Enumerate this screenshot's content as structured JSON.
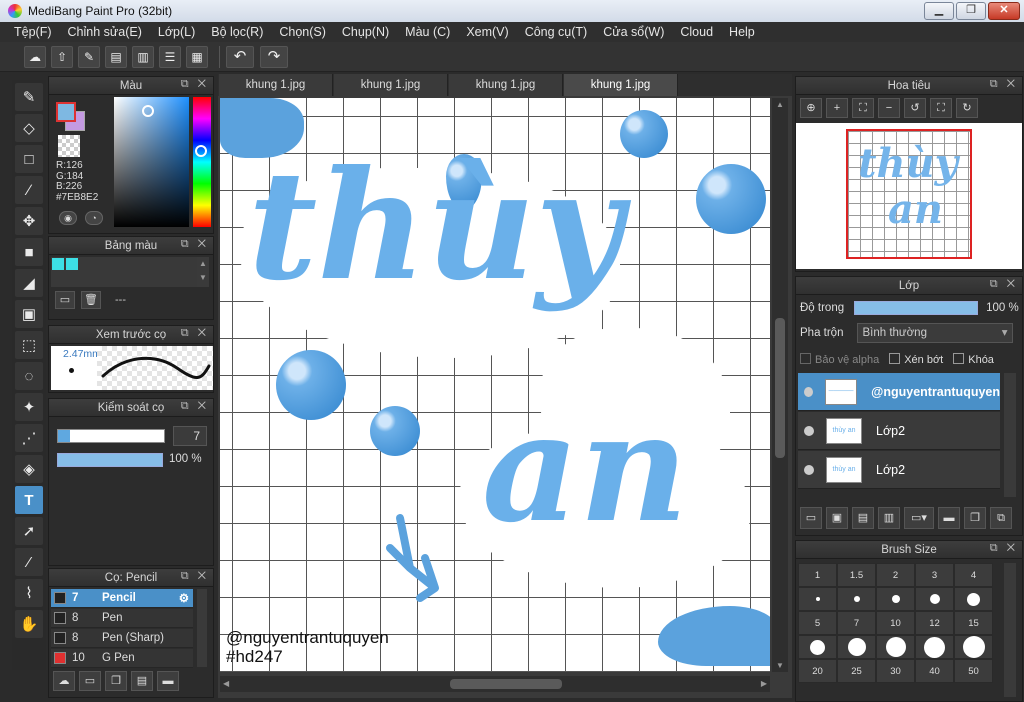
{
  "window": {
    "title": "MediBang Paint Pro (32bit)",
    "min": "▁",
    "max": "❐",
    "close": "✕"
  },
  "menu": [
    "Tệp(F)",
    "Chỉnh sửa(E)",
    "Lớp(L)",
    "Bộ lọc(R)",
    "Chọn(S)",
    "Chụp(N)",
    "Màu (C)",
    "Xem(V)",
    "Công cụ(T)",
    "Cửa sổ(W)",
    "Cloud",
    "Help"
  ],
  "toolbar": {
    "undo": "↶",
    "redo": "↷"
  },
  "color_panel": {
    "title": "Màu",
    "foreground": "#7EB8E2",
    "background": "#C49AE2",
    "r": "R:126",
    "g": "G:184",
    "b": "B:226",
    "hex": "#7EB8E2"
  },
  "palette_panel": {
    "title": "Bảng màu",
    "name": "---",
    "colors": [
      "#3DE0E6",
      "#3DE0E6"
    ]
  },
  "preview_panel": {
    "title": "Xem trước cọ",
    "size": "2.47mm"
  },
  "control_panel": {
    "title": "Kiểm soát cọ",
    "size": "7",
    "opacity": "100 %"
  },
  "brush_panel": {
    "title": "Cọ: Pencil",
    "items": [
      {
        "size": "7",
        "name": "Pencil",
        "color": "#222222"
      },
      {
        "size": "8",
        "name": "Pen",
        "color": "#222222"
      },
      {
        "size": "8",
        "name": "Pen (Sharp)",
        "color": "#222222"
      },
      {
        "size": "10",
        "name": "G Pen",
        "color": "#E03030"
      }
    ]
  },
  "canvas": {
    "tabs": [
      "khung 1.jpg",
      "khung 1.jpg",
      "khung 1.jpg",
      "khung 1.jpg"
    ],
    "active_tab": 3,
    "watermark_line1": "@nguyentrantuquyen",
    "watermark_line2": "#hd247",
    "lettering_1": "thùy",
    "lettering_2": "an",
    "accent": "#5BA2DD"
  },
  "navigator": {
    "title": "Hoa tiêu",
    "preview_1": "thùy",
    "preview_2": "an"
  },
  "layer_panel": {
    "title": "Lớp",
    "opacity_label": "Độ trong",
    "opacity_value": "100 %",
    "blend_label": "Pha trộn",
    "blend_value": "Bình thường",
    "protect_alpha": "Bảo vệ alpha",
    "clip": "Xén bớt",
    "lock": "Khóa",
    "layers": [
      {
        "name": "@nguyentrantuquyen",
        "thumb": "─────"
      },
      {
        "name": "Lớp2",
        "thumb": "thùy an"
      },
      {
        "name": "Lớp2",
        "thumb": "thùy an"
      }
    ]
  },
  "brush_size_panel": {
    "title": "Brush Size",
    "sizes": [
      "1",
      "1.5",
      "2",
      "3",
      "4",
      "5",
      "7",
      "10",
      "12",
      "15",
      "20",
      "25",
      "30",
      "40",
      "50"
    ]
  }
}
